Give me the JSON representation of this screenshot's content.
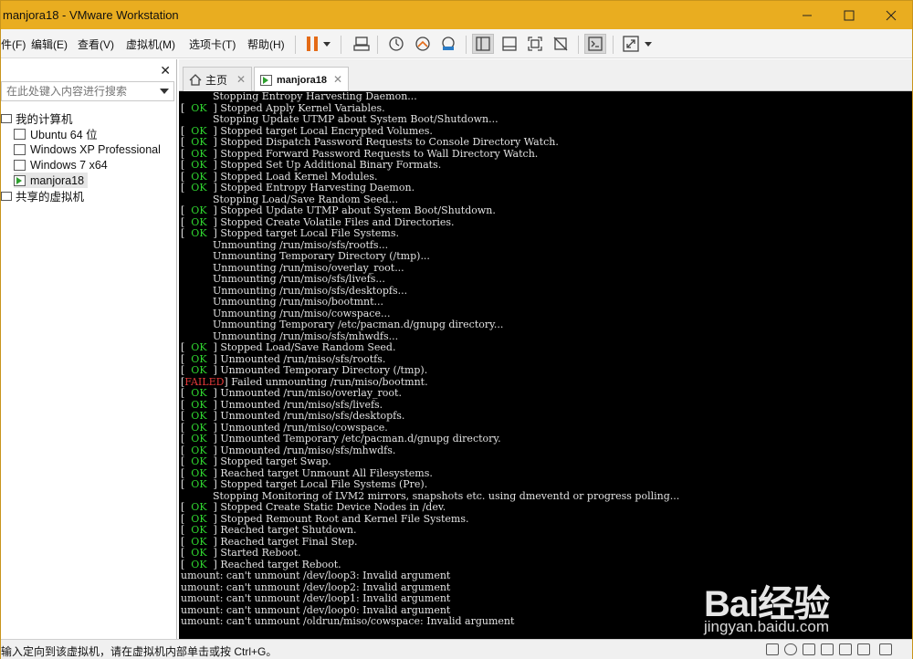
{
  "window": {
    "title": "manjora18 - VMware Workstation",
    "controls": {
      "minimize": "minimize-icon",
      "maximize": "maximize-icon",
      "close": "close-icon"
    }
  },
  "menu": [
    "件(F)",
    "编辑(E)",
    "查看(V)",
    "虚拟机(M)",
    "选项卡(T)",
    "帮助(H)"
  ],
  "toolbar": {
    "icons": [
      "pause-icon",
      "dropdown-icon",
      "send-ctrl-alt-del-icon",
      "snapshot-icon",
      "revert-snapshot-icon",
      "snapshot-manager-icon",
      "show-library-icon",
      "thumbnail-bar-icon",
      "full-screen-icon",
      "unity-icon",
      "console-view-icon",
      "stretch-icon",
      "dropdown-icon"
    ],
    "pause_color": "#e46b17"
  },
  "sidebar": {
    "search_placeholder": "在此处键入内容进行搜索",
    "root": "我的计算机",
    "vms": [
      "Ubuntu 64 位",
      "Windows XP Professional",
      "Windows 7 x64",
      "manjora18"
    ],
    "selected": "manjora18",
    "shared": "共享的虚拟机"
  },
  "tabs": [
    {
      "label": "主页",
      "active": false
    },
    {
      "label": "manjora18",
      "active": true
    }
  ],
  "console": {
    "lines": [
      {
        "status": "",
        "text": "Stopping Entropy Harvesting Daemon..."
      },
      {
        "status": "OK",
        "text": "Stopped Apply Kernel Variables."
      },
      {
        "status": "",
        "text": "Stopping Update UTMP about System Boot/Shutdown..."
      },
      {
        "status": "OK",
        "text": "Stopped target Local Encrypted Volumes."
      },
      {
        "status": "OK",
        "text": "Stopped Dispatch Password Requests to Console Directory Watch."
      },
      {
        "status": "OK",
        "text": "Stopped Forward Password Requests to Wall Directory Watch."
      },
      {
        "status": "OK",
        "text": "Stopped Set Up Additional Binary Formats."
      },
      {
        "status": "OK",
        "text": "Stopped Load Kernel Modules."
      },
      {
        "status": "OK",
        "text": "Stopped Entropy Harvesting Daemon."
      },
      {
        "status": "",
        "text": "Stopping Load/Save Random Seed..."
      },
      {
        "status": "OK",
        "text": "Stopped Update UTMP about System Boot/Shutdown."
      },
      {
        "status": "OK",
        "text": "Stopped Create Volatile Files and Directories."
      },
      {
        "status": "OK",
        "text": "Stopped target Local File Systems."
      },
      {
        "status": "",
        "text": "Unmounting /run/miso/sfs/rootfs..."
      },
      {
        "status": "",
        "text": "Unmounting Temporary Directory (/tmp)..."
      },
      {
        "status": "",
        "text": "Unmounting /run/miso/overlay_root..."
      },
      {
        "status": "",
        "text": "Unmounting /run/miso/sfs/livefs..."
      },
      {
        "status": "",
        "text": "Unmounting /run/miso/sfs/desktopfs..."
      },
      {
        "status": "",
        "text": "Unmounting /run/miso/bootmnt..."
      },
      {
        "status": "",
        "text": "Unmounting /run/miso/cowspace..."
      },
      {
        "status": "",
        "text": "Unmounting Temporary /etc/pacman.d/gnupg directory..."
      },
      {
        "status": "",
        "text": "Unmounting /run/miso/sfs/mhwdfs..."
      },
      {
        "status": "OK",
        "text": "Stopped Load/Save Random Seed."
      },
      {
        "status": "OK",
        "text": "Unmounted /run/miso/sfs/rootfs."
      },
      {
        "status": "OK",
        "text": "Unmounted Temporary Directory (/tmp)."
      },
      {
        "status": "FAILED",
        "text": "Failed unmounting /run/miso/bootmnt."
      },
      {
        "status": "OK",
        "text": "Unmounted /run/miso/overlay_root."
      },
      {
        "status": "OK",
        "text": "Unmounted /run/miso/sfs/livefs."
      },
      {
        "status": "OK",
        "text": "Unmounted /run/miso/sfs/desktopfs."
      },
      {
        "status": "OK",
        "text": "Unmounted /run/miso/cowspace."
      },
      {
        "status": "OK",
        "text": "Unmounted Temporary /etc/pacman.d/gnupg directory."
      },
      {
        "status": "OK",
        "text": "Unmounted /run/miso/sfs/mhwdfs."
      },
      {
        "status": "OK",
        "text": "Stopped target Swap."
      },
      {
        "status": "OK",
        "text": "Reached target Unmount All Filesystems."
      },
      {
        "status": "OK",
        "text": "Stopped target Local File Systems (Pre)."
      },
      {
        "status": "",
        "text": "Stopping Monitoring of LVM2 mirrors, snapshots etc. using dmeventd or progress polling..."
      },
      {
        "status": "OK",
        "text": "Stopped Create Static Device Nodes in /dev."
      },
      {
        "status": "OK",
        "text": "Stopped Remount Root and Kernel File Systems."
      },
      {
        "status": "OK",
        "text": "Reached target Shutdown."
      },
      {
        "status": "OK",
        "text": "Reached target Final Step."
      },
      {
        "status": "OK",
        "text": "Started Reboot."
      },
      {
        "status": "OK",
        "text": "Reached target Reboot."
      },
      {
        "status": "RAW",
        "text": "umount: can't unmount /dev/loop3: Invalid argument"
      },
      {
        "status": "RAW",
        "text": "umount: can't unmount /dev/loop2: Invalid argument"
      },
      {
        "status": "RAW",
        "text": "umount: can't unmount /dev/loop1: Invalid argument"
      },
      {
        "status": "RAW",
        "text": "umount: can't unmount /dev/loop0: Invalid argument"
      },
      {
        "status": "RAW",
        "text": "umount: can't unmount /oldrun/miso/cowspace: Invalid argument"
      }
    ],
    "ok_color": "#2fd42f",
    "failed_color": "#e43a3a"
  },
  "statusbar": {
    "message": "输入定向到该虚拟机，请在虚拟机内部单击或按 Ctrl+G。",
    "icons": [
      "hdd-icon",
      "cdrom-icon",
      "network-icon",
      "usb-icon",
      "sound-icon",
      "printer-icon",
      "display-icon"
    ]
  },
  "watermark": {
    "brand": "Bai经验",
    "url": "jingyan.baidu.com"
  }
}
